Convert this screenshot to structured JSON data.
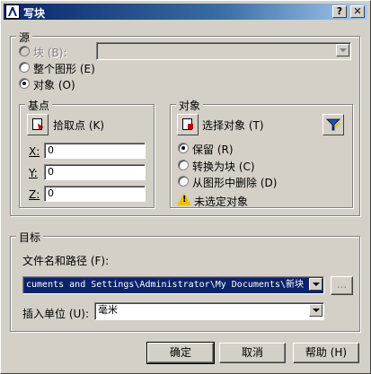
{
  "window": {
    "title": "写块",
    "help_btn": "?",
    "close_btn": "✕"
  },
  "source": {
    "legend": "源",
    "block_label": "块",
    "block_key": "(B):",
    "whole_label": "整个图形",
    "whole_key": "(E)",
    "objects_label": "对象",
    "objects_key": "(O)",
    "selected": "objects",
    "block_combo_value": ""
  },
  "basepoint": {
    "legend": "基点",
    "pick_label": "拾取点",
    "pick_key": "(K)",
    "x_label": "X:",
    "x_value": "0",
    "y_label": "Y:",
    "y_value": "0",
    "z_label": "Z:",
    "z_value": "0"
  },
  "objects": {
    "legend": "对象",
    "select_label": "选择对象",
    "select_key": "(T)",
    "retain_label": "保留",
    "retain_key": "(R)",
    "convert_label": "转换为块",
    "convert_key": "(C)",
    "delete_label": "从图形中删除",
    "delete_key": "(D)",
    "selected": "retain",
    "status": "未选定对象"
  },
  "target": {
    "legend": "目标",
    "path_label": "文件名和路径",
    "path_key": "(F):",
    "path_value": "cuments and Settings\\Administrator\\My Documents\\新块",
    "browse_label": "...",
    "units_label": "插入单位",
    "units_key": "(U):",
    "units_value": "毫米"
  },
  "footer": {
    "ok": "确定",
    "cancel": "取消",
    "help": "帮助",
    "help_key": "(H)"
  },
  "colors": {
    "title_start": "#0a246a",
    "title_end": "#a6caf0",
    "face": "#d4d0c8",
    "selection": "#0a246a"
  }
}
